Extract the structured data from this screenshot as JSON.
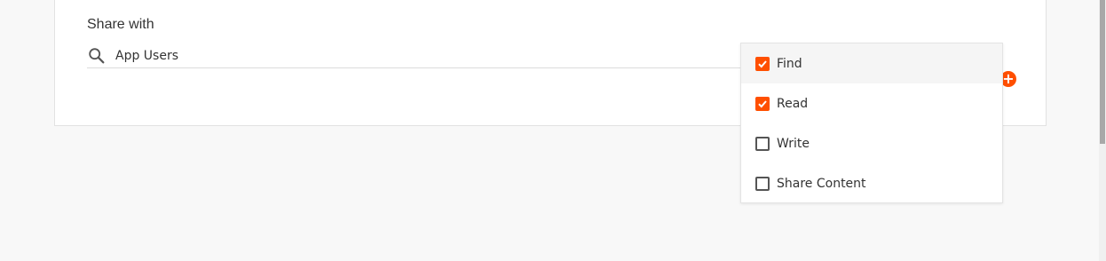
{
  "share_section": {
    "title": "Share with",
    "search": {
      "value": "App Users",
      "icon": "search-icon"
    },
    "add_button": {
      "icon": "plus-icon",
      "symbol": "+"
    }
  },
  "permissions_menu": {
    "items": [
      {
        "label": "Find",
        "checked": true
      },
      {
        "label": "Read",
        "checked": true
      },
      {
        "label": "Write",
        "checked": false
      },
      {
        "label": "Share Content",
        "checked": false
      }
    ]
  },
  "colors": {
    "accent": "#ff4f00",
    "background": "#f8f8f8",
    "card": "#ffffff",
    "text": "#333333"
  }
}
